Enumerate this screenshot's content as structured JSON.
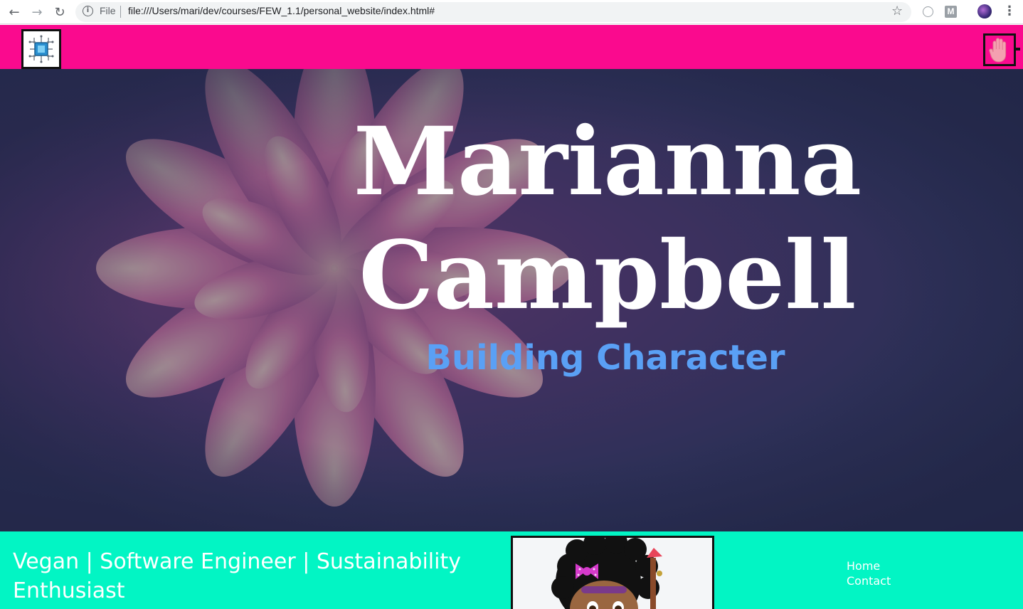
{
  "browser": {
    "scheme_label": "File",
    "url": "file:///Users/mari/dev/courses/FEW_1.1/personal_website/index.html#",
    "extension_label": "M",
    "icons": [
      "back-arrow-icon",
      "forward-arrow-icon",
      "reload-icon",
      "info-icon",
      "bookmark-star-icon",
      "extension-icon",
      "profile-avatar-icon",
      "menu-kebab-icon"
    ]
  },
  "header": {
    "logo_icon": "circuit-chip-icon",
    "menu_icon": "raised-hand-icon",
    "background": "#fa0a8e"
  },
  "hero": {
    "name_line1": "Marianna",
    "name_line2": "Campbell",
    "tagline": "Building Character",
    "tagline_color": "#5aa0f5"
  },
  "about": {
    "tagline": "Vegan | Software Engineer | Sustainability Enthusiast",
    "background": "#02f5c4"
  },
  "nav": {
    "links": [
      "Home",
      "Contact"
    ]
  }
}
